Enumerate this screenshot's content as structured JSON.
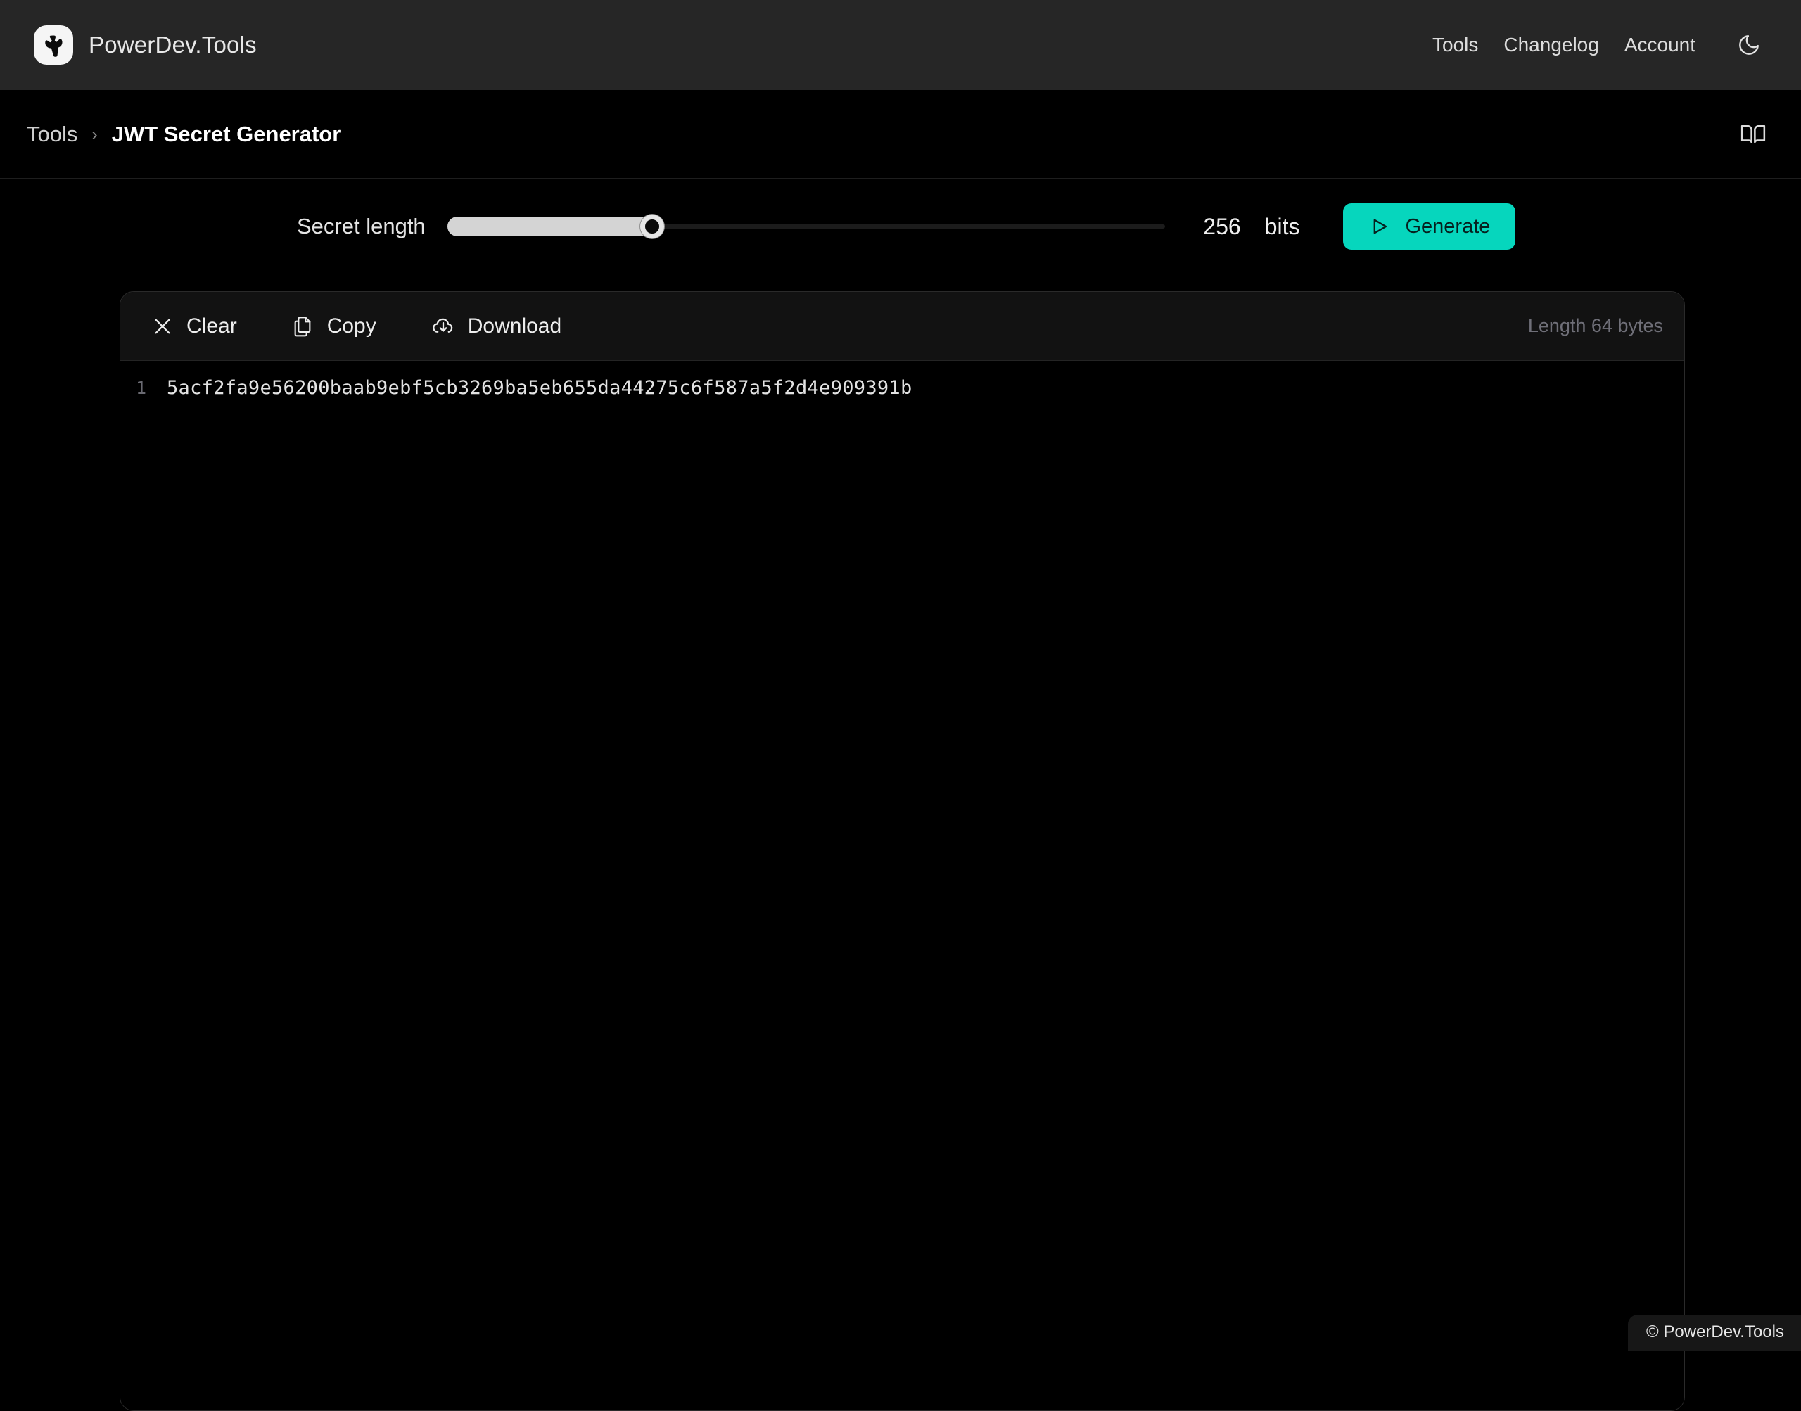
{
  "navbar": {
    "brand_name": "PowerDev.Tools",
    "logo_icon": "wrench-icon",
    "links": [
      {
        "label": "Tools",
        "name": "nav-link-tools"
      },
      {
        "label": "Changelog",
        "name": "nav-link-changelog"
      },
      {
        "label": "Account",
        "name": "nav-link-account"
      }
    ],
    "theme_toggle_icon": "moon-icon"
  },
  "breadcrumb": {
    "root": "Tools",
    "separator": "›",
    "current": "JWT Secret Generator",
    "docs_icon": "book-icon"
  },
  "controls": {
    "slider_label": "Secret length",
    "slider_value": 256,
    "slider_min": 32,
    "slider_max": 1024,
    "slider_fill_percent": 28.6,
    "value_text": "256",
    "unit_text": "bits",
    "generate_label": "Generate",
    "generate_icon": "play-icon",
    "accent_color": "#06d6bd"
  },
  "panel": {
    "toolbar": {
      "clear_label": "Clear",
      "clear_icon": "close-x-icon",
      "copy_label": "Copy",
      "copy_icon": "copy-documents-icon",
      "download_label": "Download",
      "download_icon": "cloud-download-icon",
      "meta_label": "Length 64 bytes"
    },
    "editor": {
      "line_number": "1",
      "content": "5acf2fa9e56200baab9ebf5cb3269ba5eb655da44275c6f587a5f2d4e909391b"
    }
  },
  "footer": {
    "copyright": "© PowerDev.Tools"
  }
}
